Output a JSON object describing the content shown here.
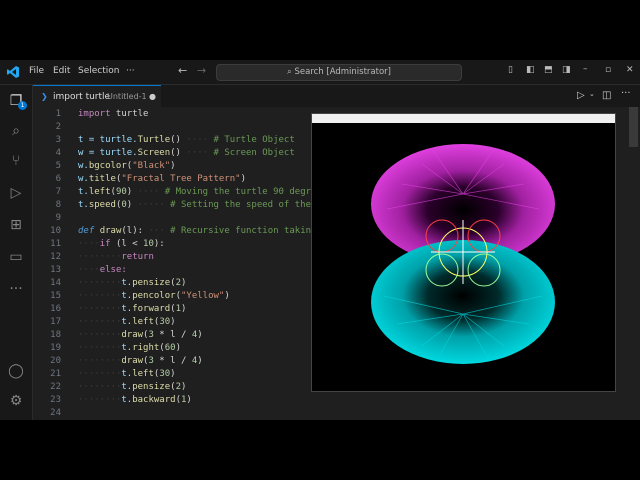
{
  "menu": {
    "file": "File",
    "edit": "Edit",
    "selection": "Selection",
    "more": "···"
  },
  "search": {
    "label": "Search [Administrator]"
  },
  "tab": {
    "title": "import turtle",
    "file": "Untitled-1"
  },
  "badge": "1",
  "lines": [
    {
      "n": "1"
    },
    {
      "n": "2"
    },
    {
      "n": "3"
    },
    {
      "n": "4"
    },
    {
      "n": "5"
    },
    {
      "n": "6"
    },
    {
      "n": "7"
    },
    {
      "n": "8"
    },
    {
      "n": "9"
    },
    {
      "n": "10"
    },
    {
      "n": "11"
    },
    {
      "n": "12"
    },
    {
      "n": "13"
    },
    {
      "n": "14"
    },
    {
      "n": "15"
    },
    {
      "n": "16"
    },
    {
      "n": "17"
    },
    {
      "n": "18"
    },
    {
      "n": "19"
    },
    {
      "n": "20"
    },
    {
      "n": "21"
    },
    {
      "n": "22"
    },
    {
      "n": "23"
    },
    {
      "n": "24"
    }
  ],
  "code": {
    "l1_kw": "import",
    "l1_rest": " turtle",
    "l3_a": "t = turtle.",
    "l3_b": "Turtle",
    "l3_c": "()",
    "l3_cmt": "# Turtle Object",
    "l4_a": "w = turtle.",
    "l4_b": "Screen",
    "l4_c": "()",
    "l4_cmt": "# Screen Object",
    "l5_a": "w.",
    "l5_b": "bgcolor",
    "l5_c": "(",
    "l5_s": "\"Black\"",
    "l5_d": ")",
    "l6_a": "w.",
    "l6_b": "title",
    "l6_c": "(",
    "l6_s": "\"Fractal Tree Pattern\"",
    "l6_d": ")",
    "l7_a": "t.",
    "l7_b": "left",
    "l7_c": "(",
    "l7_n": "90",
    "l7_d": ")",
    "l7_cmt": "# Moving the turtle 90 degree",
    "l8_a": "t.",
    "l8_b": "speed",
    "l8_c": "(",
    "l8_n": "0",
    "l8_d": ")",
    "l8_cmt": "# Setting the speed of the tu",
    "l10_def": "def",
    "l10_fn": "draw",
    "l10_p": "(l):",
    "l10_cmt": "# Recursive function taking l",
    "l11_if": "if",
    "l11_rest": " (l < ",
    "l11_n": "10",
    "l11_end": "):",
    "l12": "return",
    "l13": "else:",
    "l14_a": "t.",
    "l14_b": "pensize",
    "l14_c": "(",
    "l14_n": "2",
    "l14_d": ")",
    "l15_a": "t.",
    "l15_b": "pencolor",
    "l15_c": "(",
    "l15_s": "\"Yellow\"",
    "l15_d": ")",
    "l16_a": "t.",
    "l16_b": "forward",
    "l16_c": "(",
    "l16_n": "1",
    "l16_d": ")",
    "l17_a": "t.",
    "l17_b": "left",
    "l17_c": "(",
    "l17_n": "30",
    "l17_d": ")",
    "l18_fn": "draw",
    "l18_c": "(",
    "l18_n": "3",
    "l18_m": " * l / ",
    "l18_n2": "4",
    "l18_d": ")",
    "l19_a": "t.",
    "l19_b": "right",
    "l19_c": "(",
    "l19_n": "60",
    "l19_d": ")",
    "l20_fn": "draw",
    "l20_c": "(",
    "l20_n": "3",
    "l20_m": " * l / ",
    "l20_n2": "4",
    "l20_d": ")",
    "l21_a": "t.",
    "l21_b": "left",
    "l21_c": "(",
    "l21_n": "30",
    "l21_d": ")",
    "l22_a": "t.",
    "l22_b": "pensize",
    "l22_c": "(",
    "l22_n": "2",
    "l22_d": ")",
    "l23_a": "t.",
    "l23_b": "backward",
    "l23_c": "(",
    "l23_n": "1",
    "l23_d": ")"
  },
  "colors": {
    "accent": "#0078d4",
    "magenta": "#e040e0",
    "cyan": "#00d8e0"
  }
}
